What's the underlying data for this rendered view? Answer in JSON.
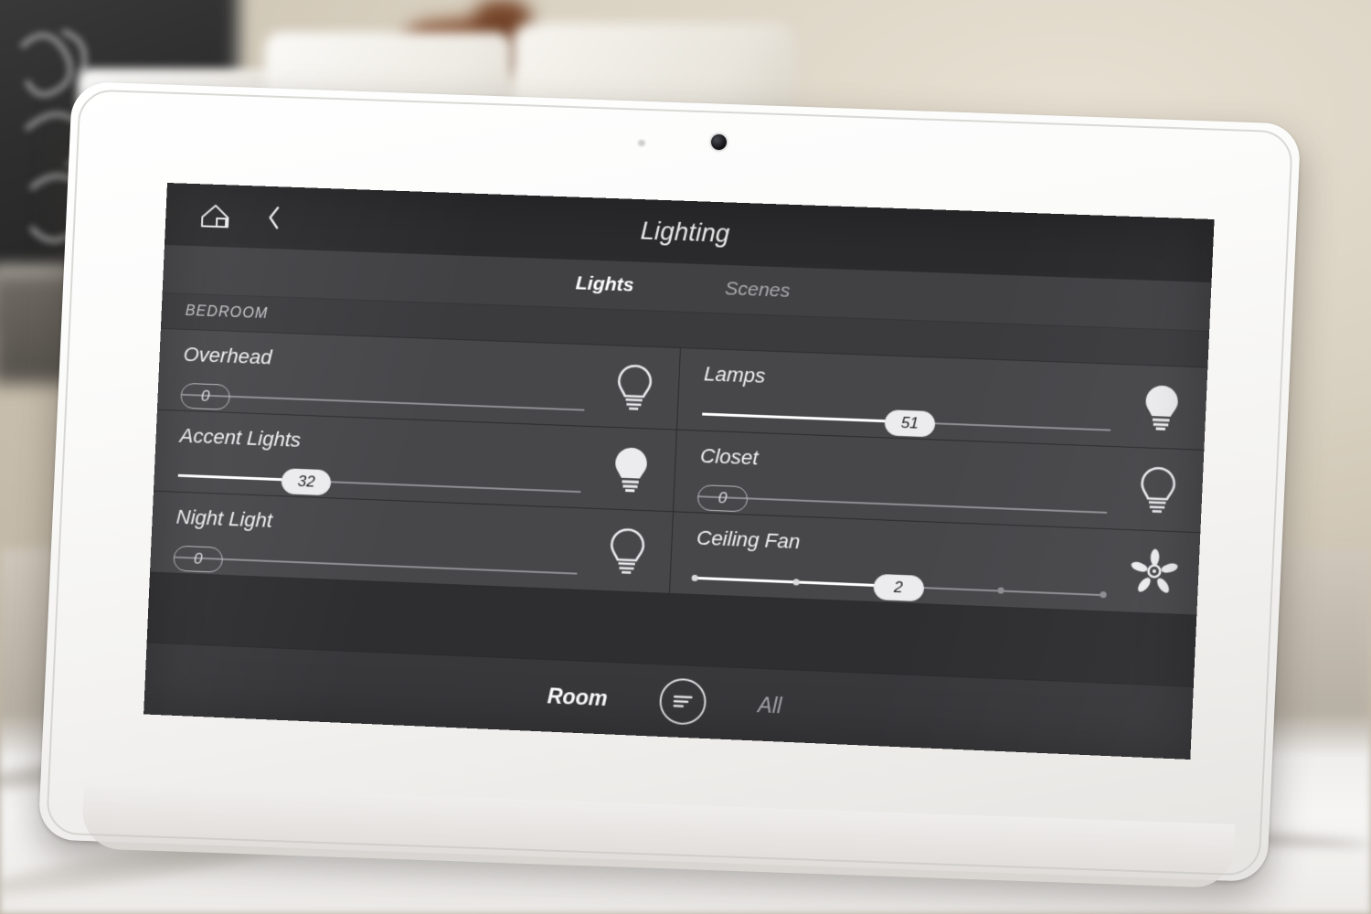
{
  "device": {
    "type": "wall-mounted touchscreen control panel",
    "camera_icon": "camera-dot"
  },
  "topbar": {
    "home_icon": "home-icon",
    "back_icon": "chevron-left-icon",
    "title": "Lighting"
  },
  "tabs": [
    {
      "label": "Lights",
      "active": true
    },
    {
      "label": "Scenes",
      "active": false
    }
  ],
  "room_header": "BEDROOM",
  "lights": [
    {
      "name": "Overhead",
      "value": "0",
      "level": 0,
      "on": false,
      "icon": "lightbulb-outline-icon",
      "type": "dimmer"
    },
    {
      "name": "Lamps",
      "value": "51",
      "level": 51,
      "on": true,
      "icon": "lightbulb-filled-icon",
      "type": "dimmer"
    },
    {
      "name": "Accent Lights",
      "value": "32",
      "level": 32,
      "on": true,
      "icon": "lightbulb-filled-icon",
      "type": "dimmer"
    },
    {
      "name": "Closet",
      "value": "0",
      "level": 0,
      "on": false,
      "icon": "lightbulb-outline-icon",
      "type": "dimmer"
    },
    {
      "name": "Night Light",
      "value": "0",
      "level": 0,
      "on": false,
      "icon": "lightbulb-outline-icon",
      "type": "dimmer"
    },
    {
      "name": "Ceiling Fan",
      "value": "2",
      "level": 50,
      "on": true,
      "icon": "ceiling-fan-icon",
      "type": "stepped",
      "steps": [
        "0",
        "1",
        "2",
        "3",
        "4"
      ],
      "step_index": 2
    }
  ],
  "bottombar": {
    "left_label": "Room",
    "left_active": true,
    "filter_icon": "sort-lines-circle-icon",
    "right_label": "All",
    "right_active": false
  },
  "colors": {
    "screen_bg": "#47474a",
    "topbar_bg": "#2b2b2d",
    "tabbar_bg": "#414144",
    "room_header_bg": "#3b3b3e",
    "bottombar_bg": "#38383b",
    "text_primary": "#ffffff",
    "text_muted": "#a9a9ac",
    "thumb_on": "#ececee",
    "track": "#8e8e92",
    "bezel": "#ffffff"
  }
}
